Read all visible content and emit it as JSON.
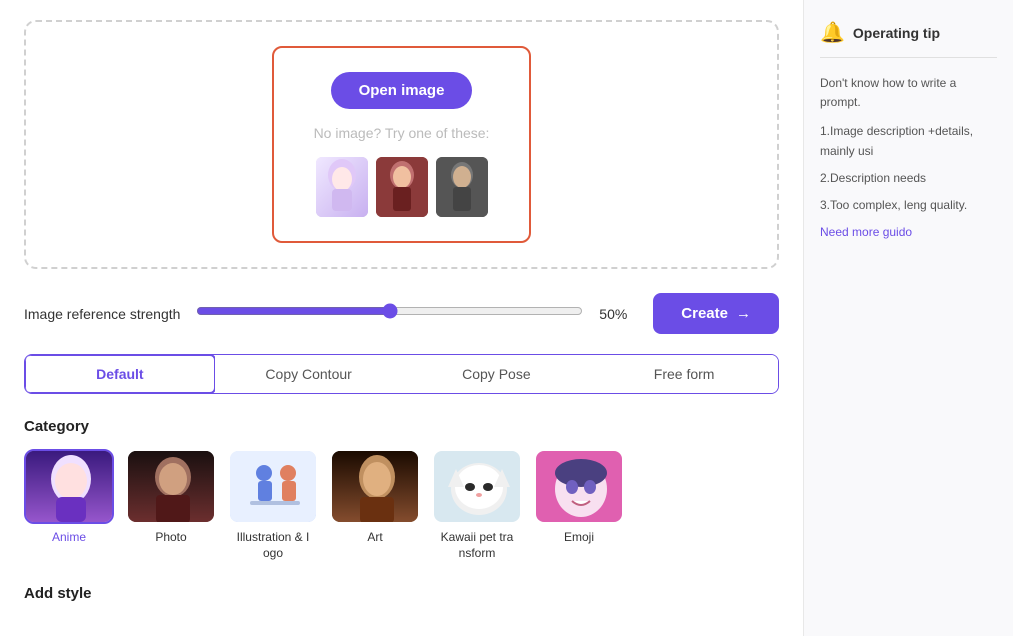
{
  "upload": {
    "open_image_label": "Open image",
    "no_image_text": "No image? Try one of these:"
  },
  "strength": {
    "label": "Image reference strength",
    "value": 50,
    "unit": "%"
  },
  "create_button": {
    "label": "Create",
    "arrow": "→"
  },
  "tabs": [
    {
      "id": "default",
      "label": "Default",
      "active": true
    },
    {
      "id": "copy-contour",
      "label": "Copy Contour",
      "active": false
    },
    {
      "id": "copy-pose",
      "label": "Copy Pose",
      "active": false
    },
    {
      "id": "free-form",
      "label": "Free form",
      "active": false
    }
  ],
  "category": {
    "title": "Category",
    "items": [
      {
        "id": "anime",
        "label": "Anime",
        "selected": true
      },
      {
        "id": "photo",
        "label": "Photo",
        "selected": false
      },
      {
        "id": "illustration",
        "label": "Illustration & I ogo",
        "selected": false
      },
      {
        "id": "art",
        "label": "Art",
        "selected": false
      },
      {
        "id": "kawaii",
        "label": "Kawaii pet tra nsform",
        "selected": false
      },
      {
        "id": "emoji",
        "label": "Emoji",
        "selected": false
      }
    ]
  },
  "add_style": {
    "title": "Add style"
  },
  "tips": {
    "title": "Operating tip",
    "intro": "Don't know how to write a prompt.",
    "item1": "1.Image description +details, mainly usi",
    "item2": "2.Description needs",
    "item3": "3.Too complex, leng quality.",
    "link": "Need more guido"
  }
}
